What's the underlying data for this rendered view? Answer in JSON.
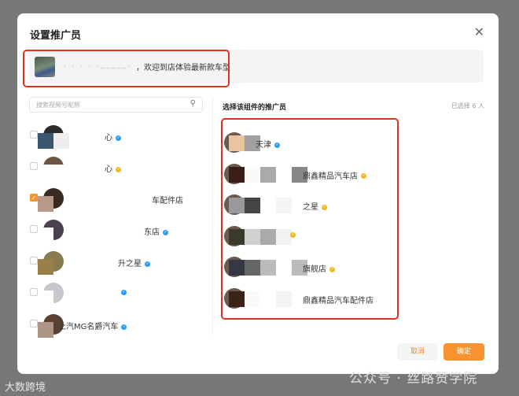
{
  "dialog": {
    "title": "设置推广员",
    "close_icon": "close-icon"
  },
  "banner": {
    "text": "，欢迎到店体验最新款车型"
  },
  "search": {
    "placeholder": "搜索视频号昵称"
  },
  "left_list": [
    {
      "name": "心",
      "badge": "blue",
      "checked": false
    },
    {
      "name": "心",
      "badge": "yellow",
      "checked": false
    },
    {
      "name": "车配件店",
      "badge": "",
      "checked": true
    },
    {
      "name": "东店",
      "badge": "blue",
      "checked": false
    },
    {
      "name": "升之星",
      "badge": "blue",
      "checked": false
    },
    {
      "name": "",
      "badge": "blue",
      "checked": false
    },
    {
      "name": "上汽MG名爵汽车",
      "badge": "blue",
      "checked": false
    }
  ],
  "right": {
    "header": "选择该组件的推广员",
    "count": "已选择 6 人",
    "items": [
      {
        "name": "天津",
        "badge": "blue"
      },
      {
        "name": "鼎鑫精品汽车店",
        "badge": "yellow"
      },
      {
        "name": "之星",
        "badge": "yellow"
      },
      {
        "name": "",
        "badge": "yellow"
      },
      {
        "name": "旗舰店",
        "badge": "yellow"
      },
      {
        "name": "鼎鑫精品汽车配件店",
        "badge": ""
      }
    ]
  },
  "buttons": {
    "cancel": "取消",
    "confirm": "确定"
  },
  "watermarks": {
    "left": "大数跨境",
    "right": "公众号 · 丝路赞学院"
  },
  "colors": {
    "accent": "#f7932f",
    "highlight": "#e0321f",
    "verified_blue": "#2a9df4",
    "verified_yellow": "#f5b91f"
  }
}
